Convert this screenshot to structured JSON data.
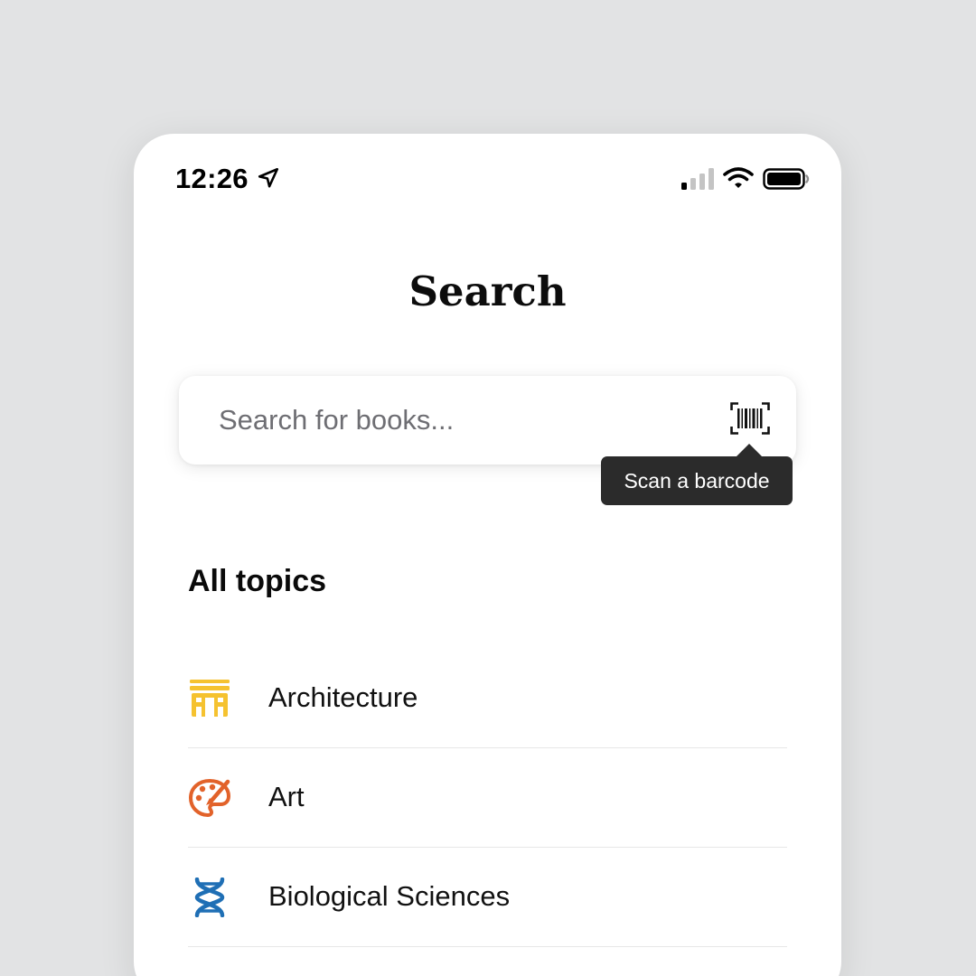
{
  "status_bar": {
    "time": "12:26"
  },
  "header": {
    "title": "Search"
  },
  "search": {
    "placeholder": "Search for books..."
  },
  "tooltip": {
    "text": "Scan a barcode"
  },
  "topics": {
    "title": "All topics",
    "items": [
      {
        "label": "Architecture",
        "icon": "building-icon",
        "color": "#f5c230"
      },
      {
        "label": "Art",
        "icon": "palette-icon",
        "color": "#e2622a"
      },
      {
        "label": "Biological Sciences",
        "icon": "dna-icon",
        "color": "#1f6fb5"
      }
    ]
  }
}
